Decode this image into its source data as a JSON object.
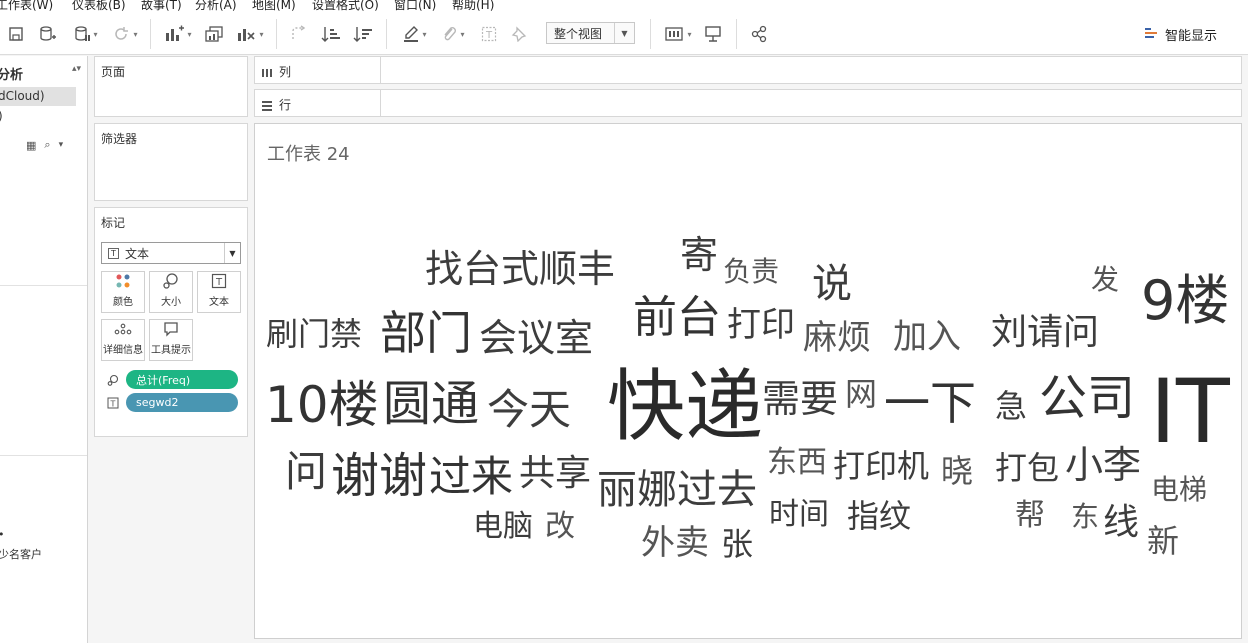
{
  "menu": [
    "工作表(W)",
    "仪表板(B)",
    "故事(T)",
    "分析(A)",
    "地图(M)",
    "设置格式(O)",
    "窗口(N)",
    "帮助(H)"
  ],
  "toolbar": {
    "view_select": "整个视图",
    "smart_label": "智能显示"
  },
  "left_pane": {
    "header": "分析",
    "datasource": "dCloud)",
    "datasource2": ")",
    "item": "少名客户"
  },
  "shelves": {
    "pages": "页面",
    "filters": "筛选器",
    "marks": "标记",
    "columns": "列",
    "rows": "行"
  },
  "marks": {
    "type": "文本",
    "buttons": [
      "颜色",
      "大小",
      "文本",
      "详细信息",
      "工具提示"
    ],
    "pills": [
      {
        "label": "总计(Freq)",
        "color": "#1db584"
      },
      {
        "label": "segwd2",
        "color": "#4996b2"
      }
    ]
  },
  "sheet": {
    "title": "工作表 24"
  },
  "words": [
    {
      "text": "找台式顺丰",
      "size": 38
    },
    {
      "text": "寄",
      "size": 38
    },
    {
      "text": "负责",
      "size": 28
    },
    {
      "text": "说",
      "size": 40
    },
    {
      "text": "发",
      "size": 28
    },
    {
      "text": "9楼",
      "size": 54
    },
    {
      "text": "刷门禁",
      "size": 32
    },
    {
      "text": "部门",
      "size": 46
    },
    {
      "text": "会议室",
      "size": 38
    },
    {
      "text": "前台",
      "size": 44
    },
    {
      "text": "打印",
      "size": 34
    },
    {
      "text": "麻烦",
      "size": 34
    },
    {
      "text": "加入",
      "size": 34
    },
    {
      "text": "刘请问",
      "size": 36
    },
    {
      "text": "10楼",
      "size": 50
    },
    {
      "text": "圆通",
      "size": 48
    },
    {
      "text": "今天",
      "size": 42
    },
    {
      "text": "快递",
      "size": 78
    },
    {
      "text": "需要",
      "size": 38
    },
    {
      "text": "网",
      "size": 32
    },
    {
      "text": "一下",
      "size": 46
    },
    {
      "text": "急",
      "size": 32
    },
    {
      "text": "公司",
      "size": 48
    },
    {
      "text": "IT",
      "size": 88
    },
    {
      "text": "问",
      "size": 42
    },
    {
      "text": "谢谢",
      "size": 48
    },
    {
      "text": "过来",
      "size": 42
    },
    {
      "text": "共享",
      "size": 36
    },
    {
      "text": "丽娜过去",
      "size": 40
    },
    {
      "text": "东西",
      "size": 30
    },
    {
      "text": "打印机",
      "size": 32
    },
    {
      "text": "晓",
      "size": 32
    },
    {
      "text": "打包",
      "size": 32
    },
    {
      "text": "小李",
      "size": 38
    },
    {
      "text": "电梯",
      "size": 28
    },
    {
      "text": "电脑",
      "size": 30
    },
    {
      "text": "改",
      "size": 30
    },
    {
      "text": "外卖",
      "size": 34
    },
    {
      "text": "张",
      "size": 32
    },
    {
      "text": "时间",
      "size": 30
    },
    {
      "text": "指纹",
      "size": 32
    },
    {
      "text": "帮",
      "size": 30
    },
    {
      "text": "东",
      "size": 28
    },
    {
      "text": "线",
      "size": 36
    },
    {
      "text": "新",
      "size": 32
    }
  ]
}
